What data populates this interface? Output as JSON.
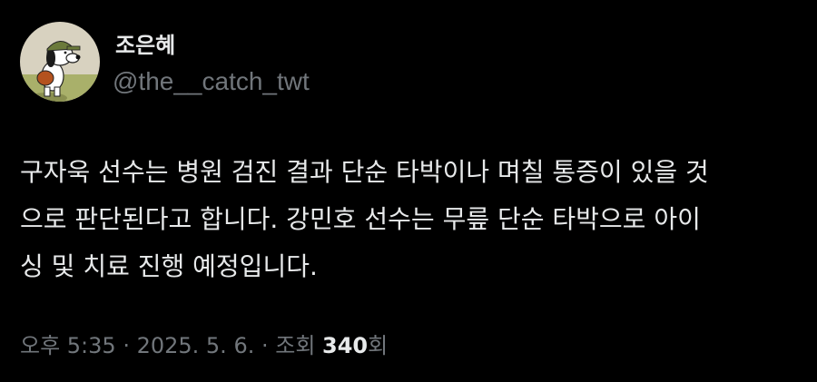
{
  "author": {
    "display_name": "조은혜",
    "handle": "@the__catch_twt",
    "avatar_icon": "snoopy-baseball-avatar-icon"
  },
  "tweet": {
    "lines": [
      "구자욱 선수는 병원 검진 결과 단순 타박이나 며칠 통증이 있을 것",
      "으로 판단된다고 합니다. 강민호 선수는 무릎 단순 타박으로 아이",
      "싱 및 치료 진행 예정입니다."
    ]
  },
  "meta": {
    "time": "오후 5:35",
    "sep1": " · ",
    "date": "2025. 5. 6.",
    "sep2": " · ",
    "views_label": "조회 ",
    "views_count": "340",
    "views_suffix": "회"
  },
  "colors": {
    "background": "#000000",
    "text_primary": "#e7e9ea",
    "text_secondary": "#71767b"
  }
}
